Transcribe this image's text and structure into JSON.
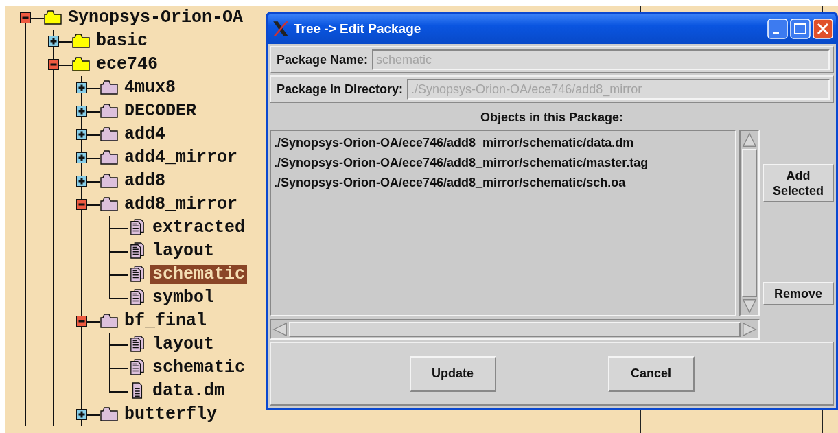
{
  "tree": [
    {
      "label": "Synopsys-Orion-OA",
      "kind": "library",
      "expanded": true,
      "selected": false,
      "children": [
        {
          "label": "basic",
          "kind": "library",
          "expanded": false,
          "selected": false
        },
        {
          "label": "ece746",
          "kind": "library",
          "expanded": true,
          "selected": false,
          "children": [
            {
              "label": "4mux8",
              "kind": "cell",
              "expanded": false,
              "selected": false
            },
            {
              "label": "DECODER",
              "kind": "cell",
              "expanded": false,
              "selected": false
            },
            {
              "label": "add4",
              "kind": "cell",
              "expanded": false,
              "selected": false
            },
            {
              "label": "add4_mirror",
              "kind": "cell",
              "expanded": false,
              "selected": false
            },
            {
              "label": "add8",
              "kind": "cell",
              "expanded": false,
              "selected": false
            },
            {
              "label": "add8_mirror",
              "kind": "cell",
              "expanded": true,
              "selected": false,
              "children": [
                {
                  "label": "extracted",
                  "kind": "view",
                  "selected": false
                },
                {
                  "label": "layout",
                  "kind": "view",
                  "selected": false
                },
                {
                  "label": "schematic",
                  "kind": "view",
                  "selected": true
                },
                {
                  "label": "symbol",
                  "kind": "view",
                  "selected": false
                }
              ]
            },
            {
              "label": "bf_final",
              "kind": "cell",
              "expanded": true,
              "selected": false,
              "children": [
                {
                  "label": "layout",
                  "kind": "view",
                  "selected": false
                },
                {
                  "label": "schematic",
                  "kind": "view",
                  "selected": false
                },
                {
                  "label": "data.dm",
                  "kind": "file",
                  "selected": false
                }
              ]
            },
            {
              "label": "butterfly",
              "kind": "cell",
              "expanded": false,
              "selected": false
            }
          ]
        }
      ]
    }
  ],
  "dialog": {
    "title": "Tree -> Edit Package",
    "fields": [
      {
        "label": "Package Name:",
        "value": "schematic",
        "disabled": true
      },
      {
        "label": "Package in Directory:",
        "value": "./Synopsys-Orion-OA/ece746/add8_mirror",
        "disabled": true
      }
    ],
    "objects_heading": "Objects in this Package:",
    "objects": [
      "./Synopsys-Orion-OA/ece746/add8_mirror/schematic/data.dm",
      "./Synopsys-Orion-OA/ece746/add8_mirror/schematic/master.tag",
      "./Synopsys-Orion-OA/ece746/add8_mirror/schematic/sch.oa"
    ],
    "side_buttons": [
      "Add Selected",
      "Remove"
    ],
    "buttons": [
      "Update",
      "Cancel"
    ]
  }
}
